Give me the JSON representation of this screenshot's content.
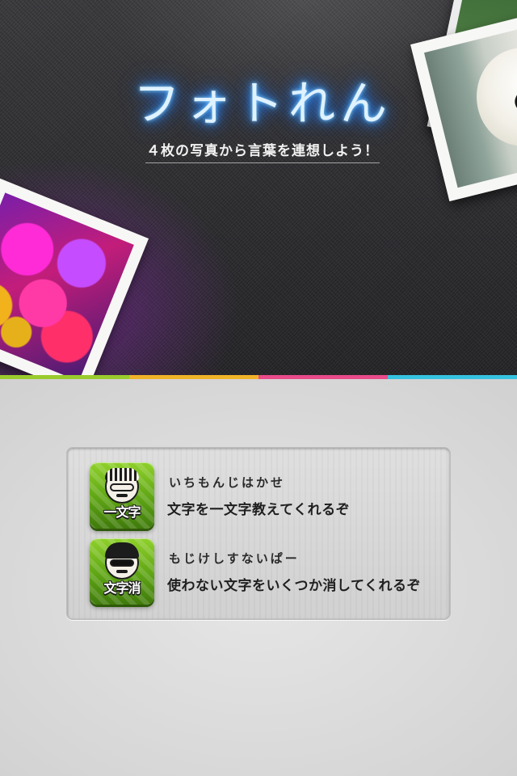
{
  "header": {
    "app_title": "フォトれん",
    "tagline": "４枚の写真から言葉を連想しよう！"
  },
  "photos": [
    {
      "name": "polar-bear-photo"
    },
    {
      "name": "flower-photo"
    },
    {
      "name": "background-photo"
    }
  ],
  "divider_colors": [
    "#9acb2e",
    "#f0b428",
    "#e84a8a",
    "#35c3df"
  ],
  "hints": [
    {
      "icon_label": "一文字",
      "icon": "glasses-face-icon",
      "name": "いちもんじはかせ",
      "description": "文字を一文字教えてくれるぞ"
    },
    {
      "icon_label": "文字消",
      "icon": "sunglasses-face-icon",
      "name": "もじけしすないぱー",
      "description": "使わない文字をいくつか消してくれるぞ"
    }
  ],
  "colors": {
    "button_green": "#5ea414",
    "neon_blue": "#39a5ff"
  }
}
